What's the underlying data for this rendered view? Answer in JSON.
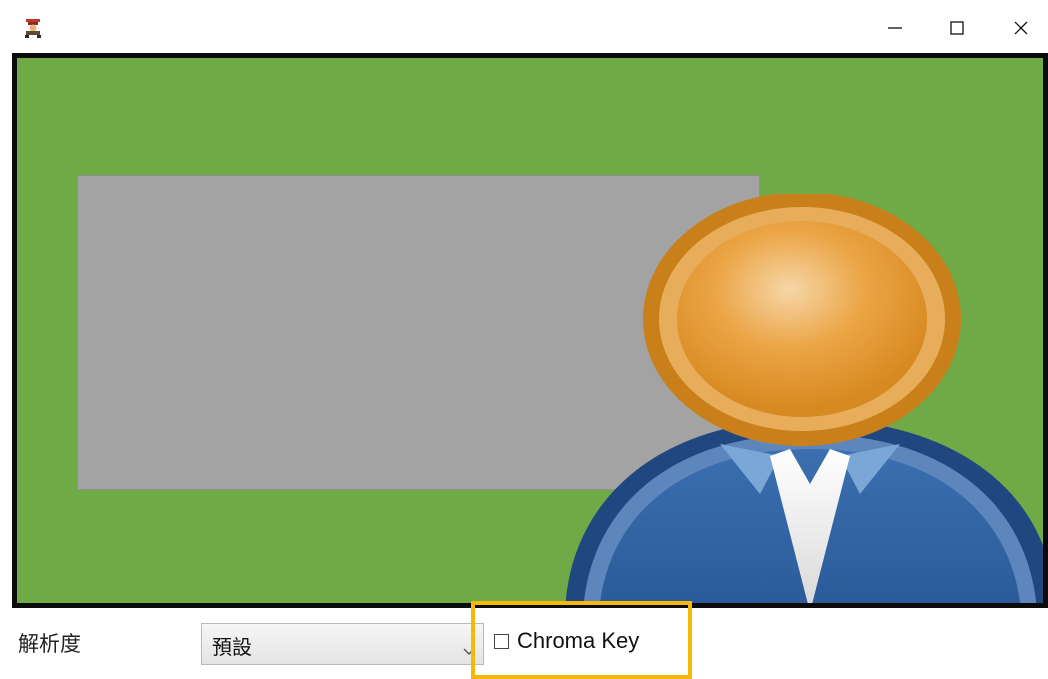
{
  "window": {
    "app_icon": "app-icon",
    "minimize_glyph": "–",
    "maximize_glyph": "☐",
    "close_glyph": "✕"
  },
  "viewport": {
    "background_color": "#6faa46",
    "placeholder_color": "#a3a3a3",
    "avatar_icon": "user-avatar-icon"
  },
  "controls": {
    "resolution_label": "解析度",
    "resolution_value": "預設",
    "chroma_key_label": "Chroma Key",
    "chroma_key_checked": false,
    "highlight_color": "#f6b80a"
  }
}
